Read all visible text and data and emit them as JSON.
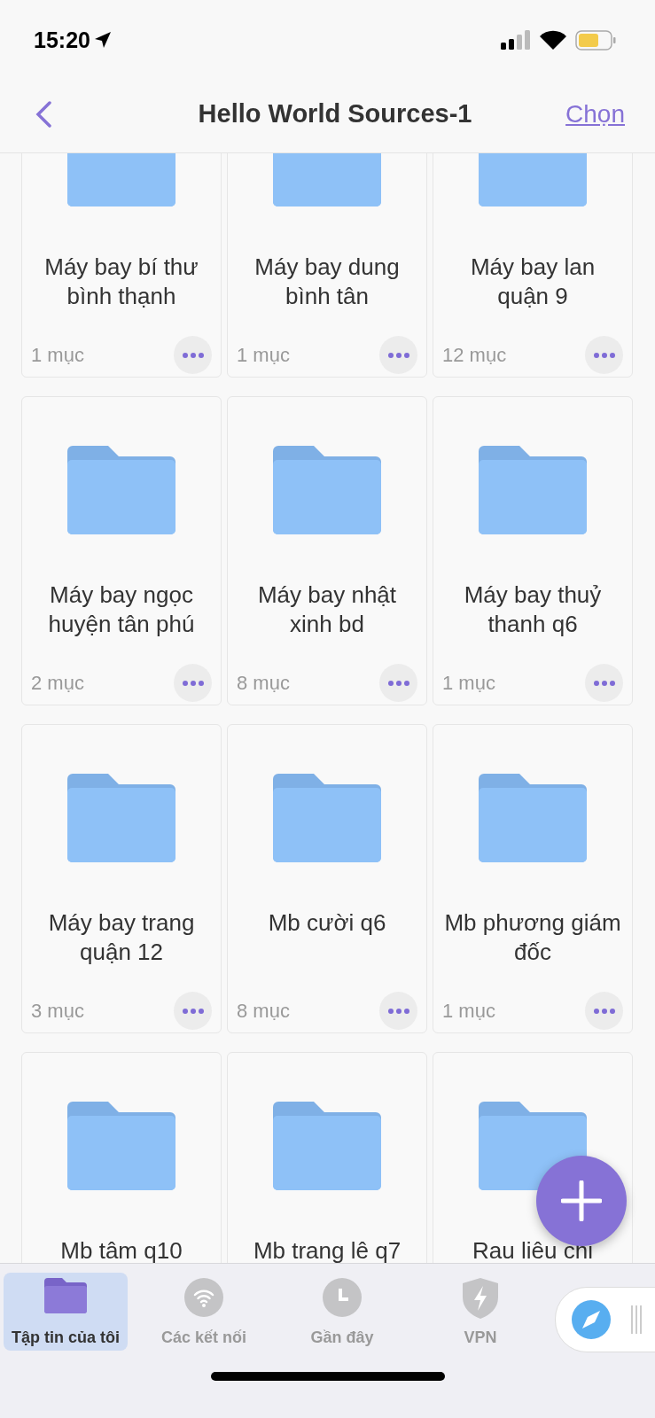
{
  "status_bar": {
    "time": "15:20"
  },
  "nav": {
    "title": "Hello World Sources-1",
    "action": "Chọn"
  },
  "folders": [
    {
      "name": "Máy bay bí thư bình thạnh",
      "count": "1 mục"
    },
    {
      "name": "Máy bay dung bình tân",
      "count": "1 mục"
    },
    {
      "name": "Máy bay lan quận 9",
      "count": "12 mục"
    },
    {
      "name": "Máy bay ngọc huyện tân phú",
      "count": "2 mục"
    },
    {
      "name": "Máy bay nhật xinh bd",
      "count": "8 mục"
    },
    {
      "name": "Máy bay thuỷ thanh q6",
      "count": "1 mục"
    },
    {
      "name": "Máy bay trang quận 12",
      "count": "3 mục"
    },
    {
      "name": "Mb cười q6",
      "count": "8 mục"
    },
    {
      "name": "Mb phương giám đốc",
      "count": "1 mục"
    },
    {
      "name": "Mb tâm q10"
    },
    {
      "name": "Mb trang lê q7"
    },
    {
      "name": "Rau liêu chi"
    }
  ],
  "tabs": [
    {
      "label": "Tập tin của tôi",
      "kind": "folder",
      "selected": true
    },
    {
      "label": "Các kết nối",
      "kind": "wifi",
      "selected": false
    },
    {
      "label": "Gần đây",
      "kind": "clock",
      "selected": false
    },
    {
      "label": "VPN",
      "kind": "shield",
      "selected": false
    }
  ]
}
